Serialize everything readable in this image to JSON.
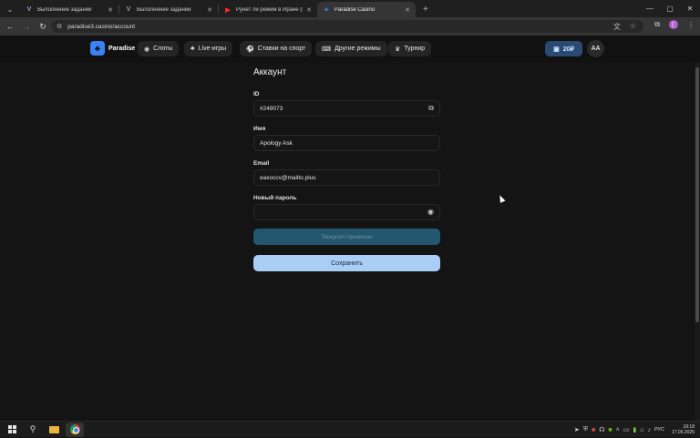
{
  "browser": {
    "tabs": [
      {
        "label": "Выполнение заданий",
        "favicon": "V",
        "favicon_color": "#8aa0c8"
      },
      {
        "label": "Выполнение заданий",
        "favicon": "V",
        "favicon_color": "#8aa0c8"
      },
      {
        "label": "Рунет ли режим в Иране (Em",
        "favicon": "▶",
        "favicon_color": "#ff2a2a"
      },
      {
        "label": "Paradise Casino",
        "favicon": "✦",
        "favicon_color": "#3b82f6"
      }
    ],
    "active_tab": 3,
    "url": "paradise3.casino/account",
    "profile_initial": "E"
  },
  "site": {
    "logo_text": "Paradise",
    "nav": [
      {
        "label": "Слоты",
        "icon": "gamepad-icon"
      },
      {
        "label": "Live-игры",
        "icon": "club-icon"
      },
      {
        "label": "Ставки на спорт",
        "icon": "ball-icon"
      },
      {
        "label": "Другие режимы",
        "icon": "controller-icon"
      },
      {
        "label": "Турнир",
        "icon": "trophy-icon"
      }
    ],
    "balance": "20₽",
    "avatar_initials": "AA"
  },
  "account": {
    "title": "Аккаунт",
    "id_label": "ID",
    "id_value": "#249073",
    "name_label": "Имя",
    "name_value": "Apology Ask",
    "email_label": "Email",
    "email_value": "eaxoccv@mailto.plus",
    "password_label": "Новый пароль",
    "password_value": "",
    "telegram_button": "Telegram привязан",
    "save_button": "Сохранить"
  },
  "taskbar": {
    "language": "РУС",
    "time": "18:18",
    "date": "17.06.2025"
  }
}
